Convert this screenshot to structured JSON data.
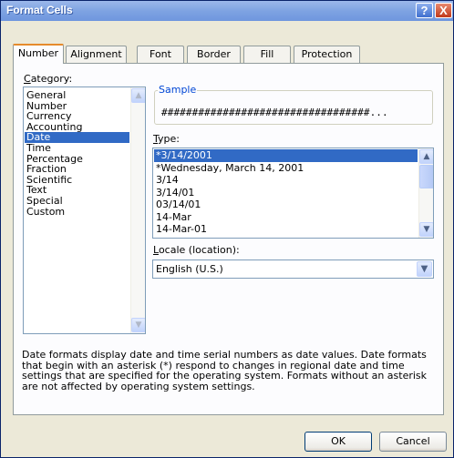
{
  "window": {
    "title": "Format Cells",
    "help_symbol": "?",
    "close_symbol": "X"
  },
  "tabs": [
    {
      "label": "Number",
      "active": true
    },
    {
      "label": "Alignment"
    },
    {
      "label": "Font"
    },
    {
      "label": "Border"
    },
    {
      "label": "Fill"
    },
    {
      "label": "Protection"
    }
  ],
  "category": {
    "label": "Category:",
    "items": [
      "General",
      "Number",
      "Currency",
      "Accounting",
      "Date",
      "Time",
      "Percentage",
      "Fraction",
      "Scientific",
      "Text",
      "Special",
      "Custom"
    ],
    "selected": "Date"
  },
  "sample": {
    "label": "Sample",
    "value": "##################################..."
  },
  "type": {
    "label": "Type:",
    "items": [
      "*3/14/2001",
      "*Wednesday, March 14, 2001",
      "3/14",
      "3/14/01",
      "03/14/01",
      "14-Mar",
      "14-Mar-01"
    ],
    "selected": "*3/14/2001"
  },
  "locale": {
    "label": "Locale (location):",
    "value": "English (U.S.)"
  },
  "description": "Date formats display date and time serial numbers as date values.  Date formats that begin with an asterisk (*) respond to changes in regional date and time settings that are specified for the operating system. Formats without an asterisk are not affected by operating system settings.",
  "buttons": {
    "ok": "OK",
    "cancel": "Cancel"
  },
  "colors": {
    "title_bar": "#7ea3e2",
    "selection": "#316ac5",
    "active_tab_accent": "#e68b2c",
    "group_label": "#0046d5"
  },
  "icons": {
    "scroll_up": "chevron-up-icon",
    "scroll_down": "chevron-down-icon",
    "dropdown": "chevron-down-icon"
  }
}
